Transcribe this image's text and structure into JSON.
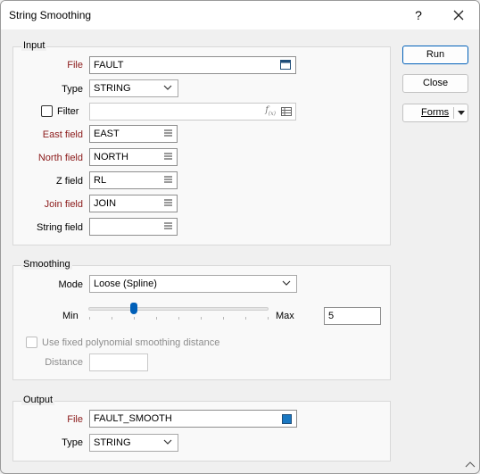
{
  "window": {
    "title": "String Smoothing",
    "help_label": "?",
    "close_label": "✕"
  },
  "buttons": {
    "run": "Run",
    "close": "Close",
    "forms": "Forms"
  },
  "input": {
    "group_title": "Input",
    "file_label": "File",
    "file_value": "FAULT",
    "type_label": "Type",
    "type_value": "STRING",
    "filter_label": "Filter",
    "filter_value": "",
    "filter_checked": false,
    "east_label": "East field",
    "east_value": "EAST",
    "north_label": "North field",
    "north_value": "NORTH",
    "z_label": "Z field",
    "z_value": "RL",
    "join_label": "Join field",
    "join_value": "JOIN",
    "string_label": "String field",
    "string_value": ""
  },
  "smoothing": {
    "group_title": "Smoothing",
    "mode_label": "Mode",
    "mode_value": "Loose (Spline)",
    "min_label": "Min",
    "max_label": "Max",
    "slider_fraction": 0.25,
    "slider_value": "5",
    "fixed_label": "Use fixed polynomial smoothing distance",
    "fixed_checked": false,
    "distance_label": "Distance",
    "distance_value": ""
  },
  "output": {
    "group_title": "Output",
    "file_label": "File",
    "file_value": "FAULT_SMOOTH",
    "type_label": "Type",
    "type_value": "STRING"
  },
  "colors": {
    "accent": "#005fb8",
    "required_label": "#8b1a1a"
  },
  "icons": {
    "help": "help-icon",
    "close": "close-icon",
    "file_browse": "file-browse-icon",
    "dropdown": "chevron-down-icon",
    "field_list": "list-icon",
    "expression": "function-icon",
    "table": "table-icon",
    "forms_menu": "triangle-down-icon",
    "color_swatch": "color-swatch-icon",
    "resize": "resize-grip-icon"
  }
}
